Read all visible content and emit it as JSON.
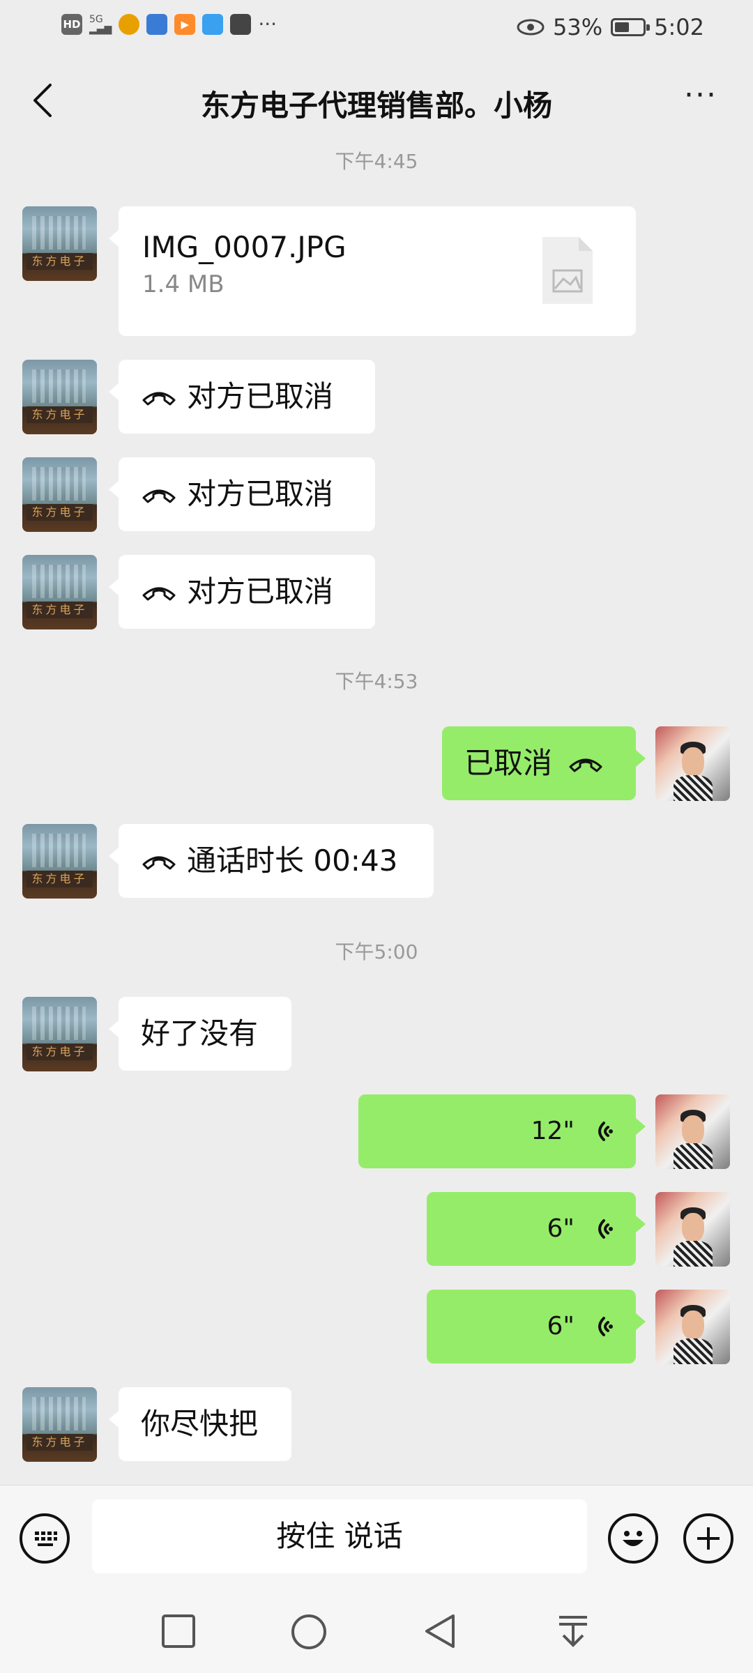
{
  "status_bar": {
    "hd": "HD",
    "net": "5G",
    "extra": "···",
    "battery_percent": "53%",
    "battery_level": 0.53,
    "time": "5:02"
  },
  "header": {
    "title": "东方电子代理销售部。小杨",
    "more": "···"
  },
  "messages": {
    "t1": "下午4:45",
    "file": {
      "name": "IMG_0007.JPG",
      "size": "1.4 MB"
    },
    "call1": "对方已取消",
    "call2": "对方已取消",
    "call3": "对方已取消",
    "t2": "下午4:53",
    "out_call": "已取消",
    "call_duration": "通话时长 00:43",
    "t3": "下午5:00",
    "text1": "好了没有",
    "voice1": "12\"",
    "voice2": "6\"",
    "voice3": "6\"",
    "text2": "你尽快把"
  },
  "avatar_sign": "东方电子",
  "input": {
    "hold_to_talk": "按住 说话"
  },
  "colors": {
    "bg": "#ededed",
    "bubble_out": "#95ec69",
    "bubble_in": "#ffffff"
  },
  "icons": [
    "back-icon",
    "more-icon",
    "file-image-icon",
    "phone-hangup-icon",
    "voice-wave-icon",
    "keyboard-icon",
    "emoji-icon",
    "plus-icon",
    "square-nav-icon",
    "home-nav-icon",
    "back-nav-icon",
    "down-nav-icon"
  ]
}
